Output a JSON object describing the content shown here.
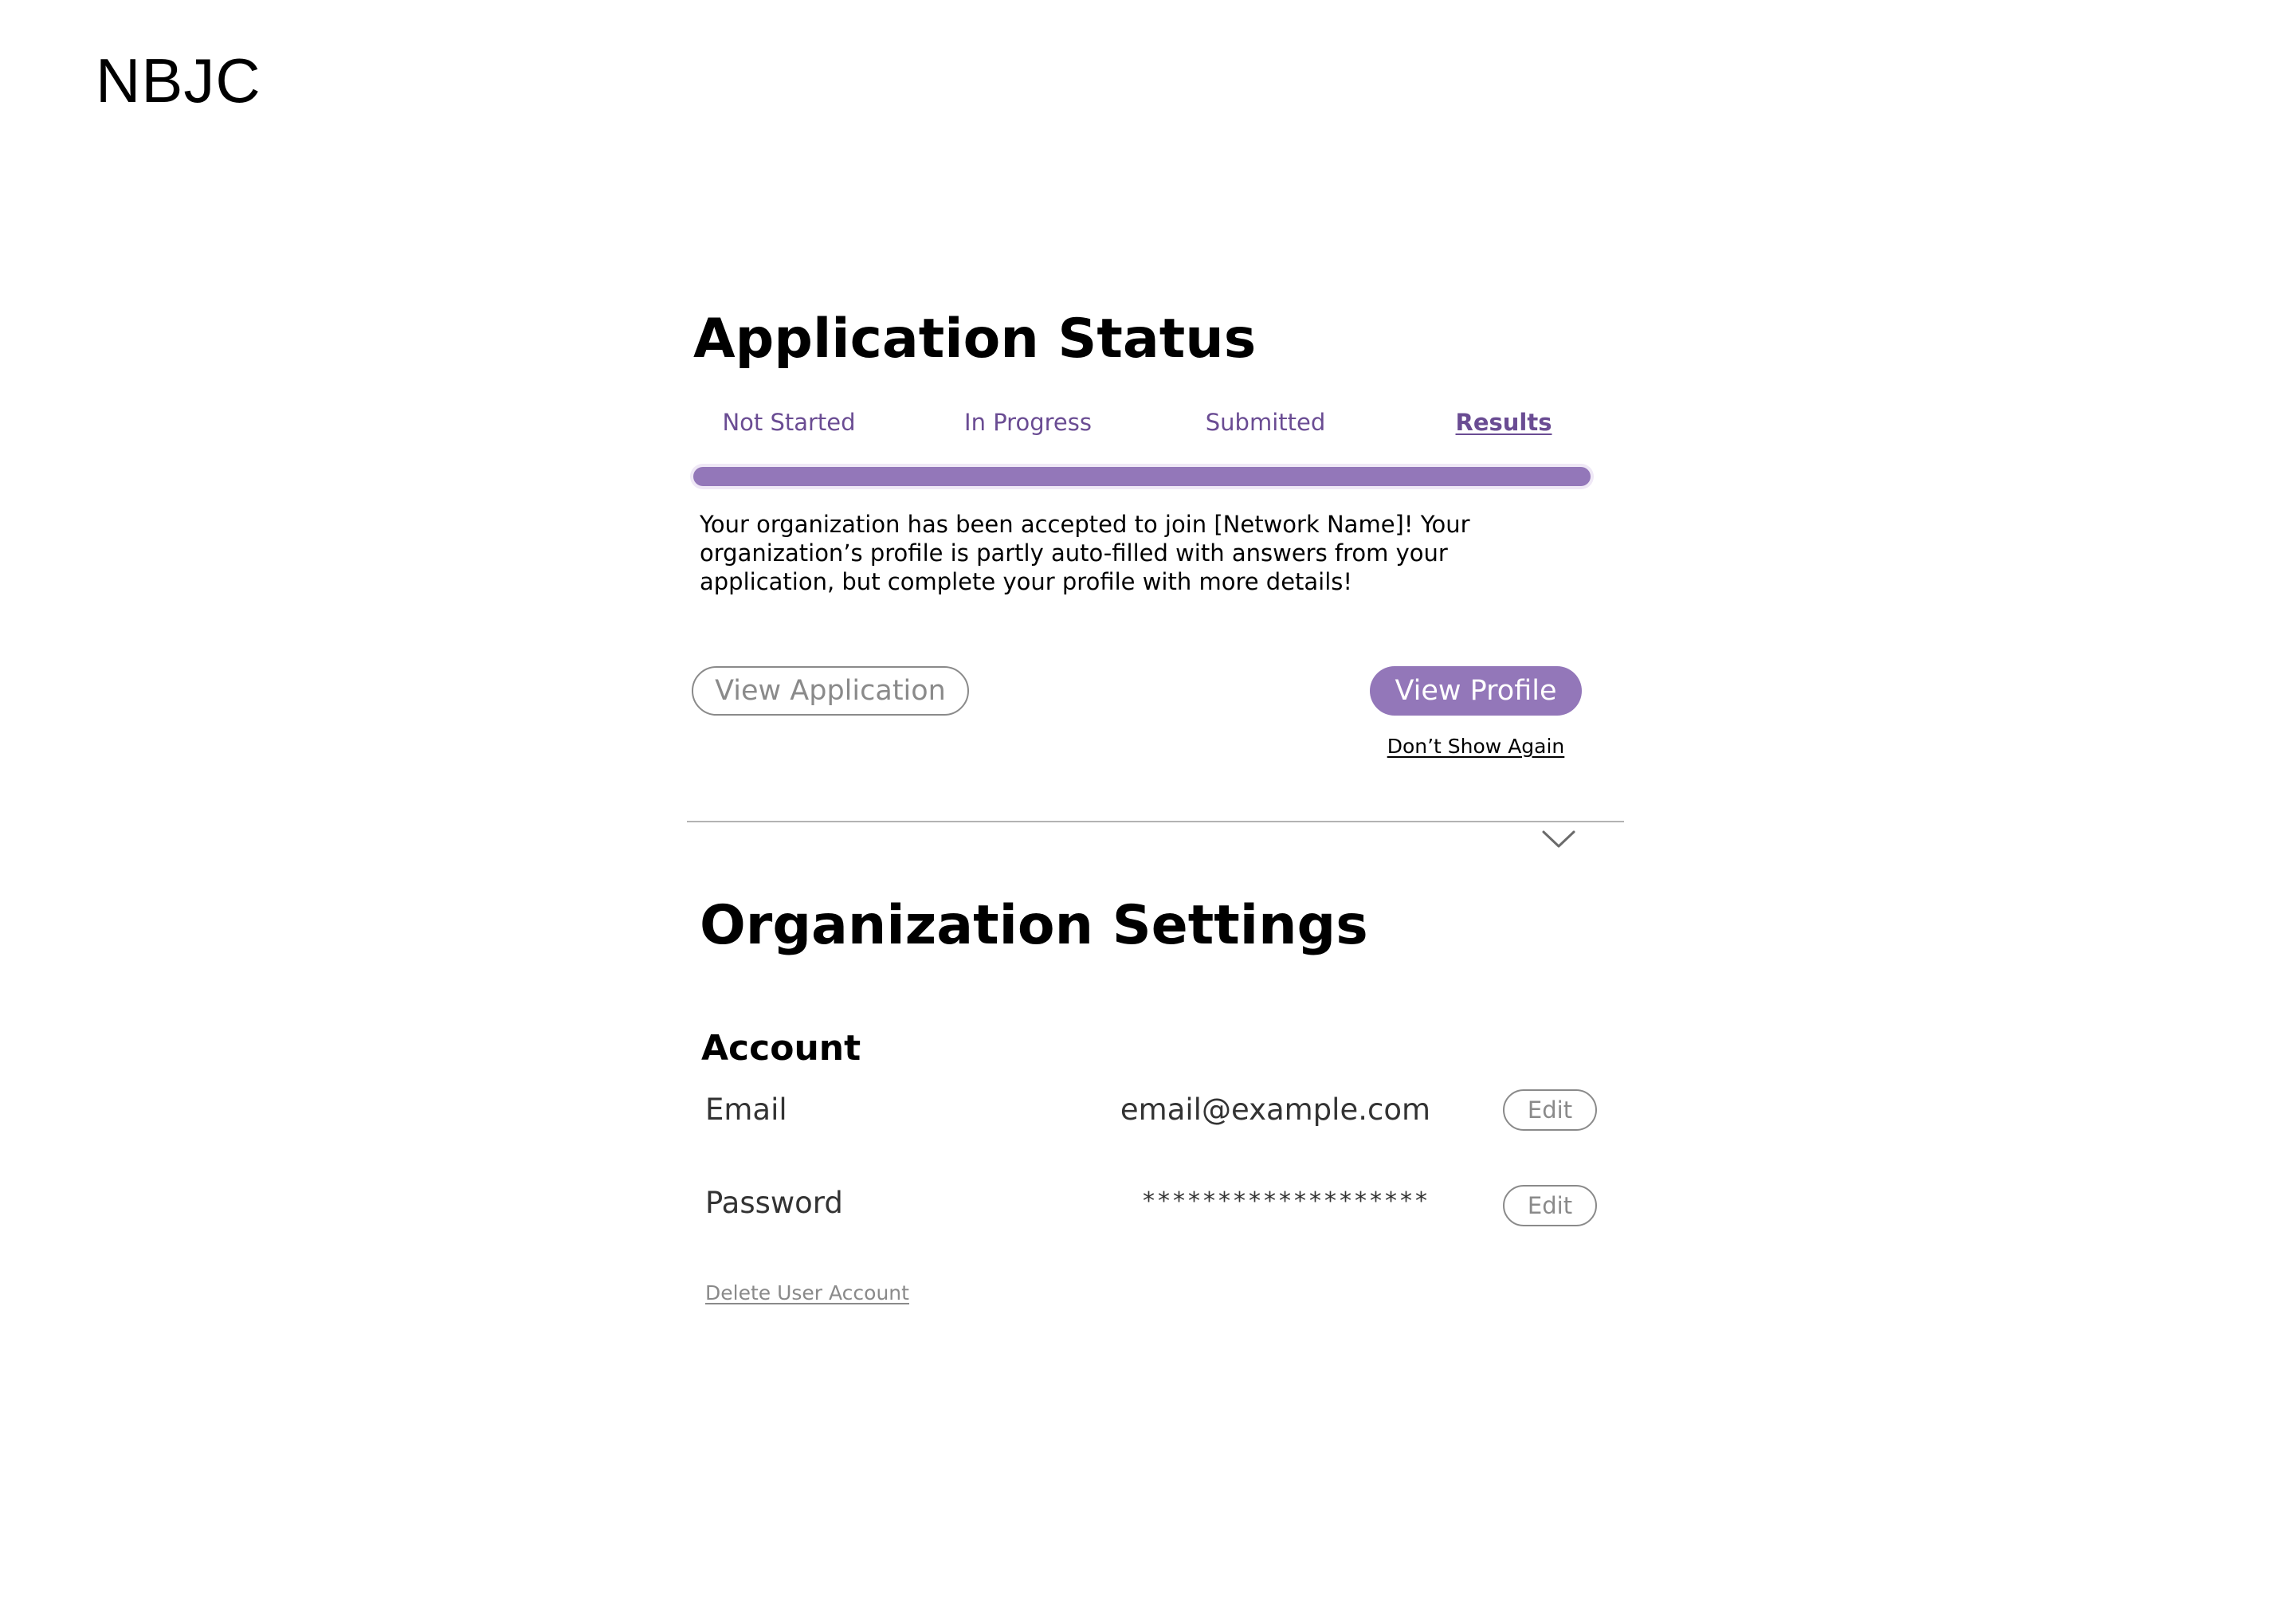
{
  "brand": {
    "logo_text": "NBJC"
  },
  "application_status": {
    "title": "Application Status",
    "steps": [
      {
        "label": "Not Started",
        "active": false
      },
      {
        "label": "In Progress",
        "active": false
      },
      {
        "label": "Submitted",
        "active": false
      },
      {
        "label": "Results",
        "active": true
      }
    ],
    "progress": 1.0,
    "message": "Your organization has been accepted to join [Network Name]! Your organization’s profile is partly auto-filled with answers from your application, but complete your profile with more details!",
    "view_application_label": "View Application",
    "view_profile_label": "View Profile",
    "dont_show_again_label": "Don’t Show Again"
  },
  "organization_settings": {
    "title": "Organization Settings",
    "account": {
      "heading": "Account",
      "rows": [
        {
          "label": "Email",
          "value": "email@example.com",
          "edit_label": "Edit"
        },
        {
          "label": "Password",
          "value": "*******************",
          "edit_label": "Edit"
        }
      ],
      "delete_label": "Delete User Account"
    }
  },
  "colors": {
    "accent": "#9377b9",
    "accent_text": "#6a4c93",
    "muted": "#8a8a8a"
  },
  "icons": {
    "collapse": "chevron-down-icon"
  }
}
